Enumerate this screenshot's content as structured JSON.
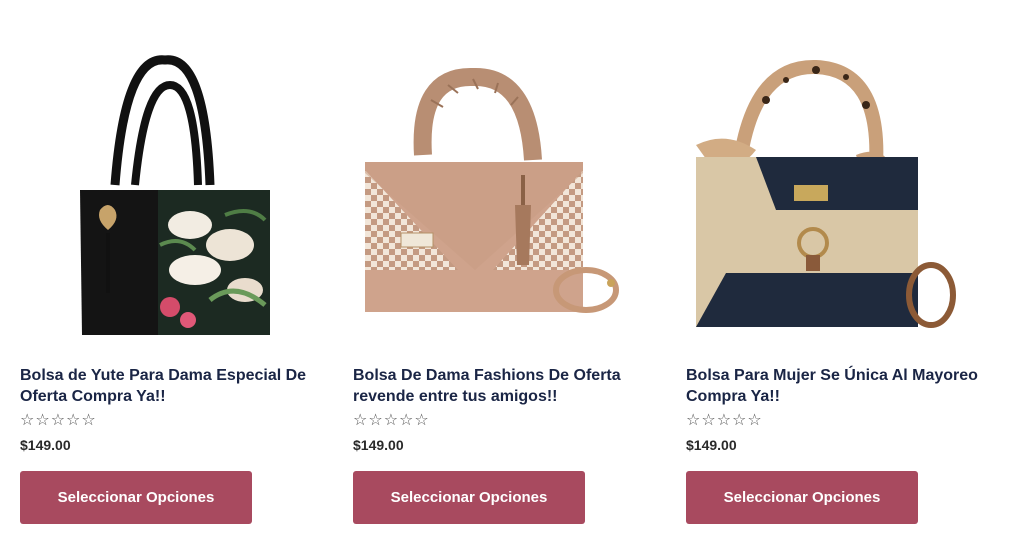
{
  "products": [
    {
      "title": "Bolsa de Yute Para Dama Especial De Oferta Compra Ya!!",
      "rating_stars": "☆☆☆☆☆",
      "price": "$149.00",
      "button_label": "Seleccionar Opciones"
    },
    {
      "title": "Bolsa De Dama Fashions De Oferta revende entre tus amigos!!",
      "rating_stars": "☆☆☆☆☆",
      "price": "$149.00",
      "button_label": "Seleccionar Opciones"
    },
    {
      "title": "Bolsa Para Mujer Se Única Al Mayoreo Compra Ya!!",
      "rating_stars": "☆☆☆☆☆",
      "price": "$149.00",
      "button_label": "Seleccionar Opciones"
    }
  ],
  "colors": {
    "button_bg": "#a84a5f",
    "title_text": "#1a2545"
  }
}
